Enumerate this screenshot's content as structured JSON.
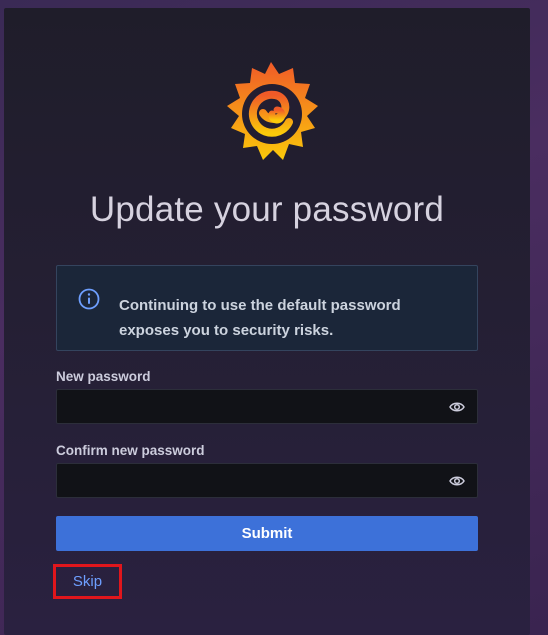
{
  "page": {
    "title": "Update your password"
  },
  "alert": {
    "icon": "info-icon",
    "message": "Continuing to use the default password exposes you to security risks."
  },
  "form": {
    "new_password": {
      "label": "New password",
      "value": "",
      "icon": "eye-icon"
    },
    "confirm_password": {
      "label": "Confirm new password",
      "value": "",
      "icon": "eye-icon"
    },
    "submit_label": "Submit",
    "skip_label": "Skip"
  },
  "colors": {
    "accent": "#3d71d9",
    "link": "#6e9fff",
    "highlight_box": "#e0161c",
    "logo_gradient": [
      "#f05a28",
      "#fbca0a"
    ]
  }
}
